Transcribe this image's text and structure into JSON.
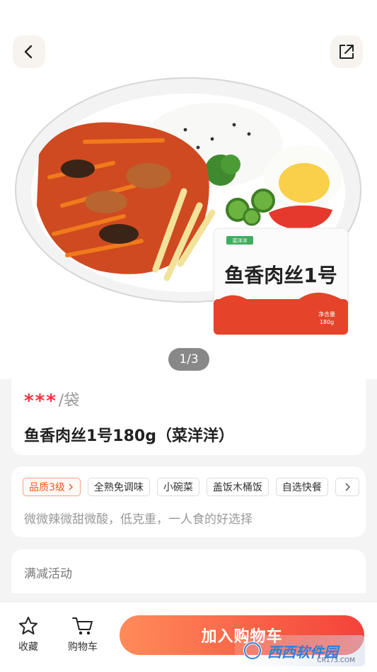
{
  "hero": {
    "image_counter": "1/3"
  },
  "package": {
    "brand": "菜洋洋",
    "name": "鱼香肉丝1号",
    "net_label": "净含量",
    "net_value": "180g"
  },
  "product": {
    "price_masked": "***",
    "price_unit": "/袋",
    "title": "鱼香肉丝1号180g（菜洋洋）"
  },
  "tags": {
    "quality": "品质3级",
    "items": [
      "全熟免调味",
      "小碗菜",
      "盖饭木桶饭",
      "自选快餐"
    ]
  },
  "description": "微微辣微甜微酸，低克重，一人食的好选择",
  "promo": {
    "label": "满减活动"
  },
  "bottom": {
    "favorite_label": "收藏",
    "cart_label": "购物车",
    "add_to_cart_label": "加入购物车"
  },
  "watermark": {
    "text": "西西软件园",
    "sub": "CR173.COM"
  },
  "icons": {
    "back": "chevron-left-icon",
    "share": "share-icon",
    "favorite": "star-icon",
    "cart": "cart-icon",
    "more": "chevron-right-icon"
  },
  "colors": {
    "accent": "#f4423a",
    "price": "#f2333b",
    "quality_tag": "#ee5a24"
  }
}
